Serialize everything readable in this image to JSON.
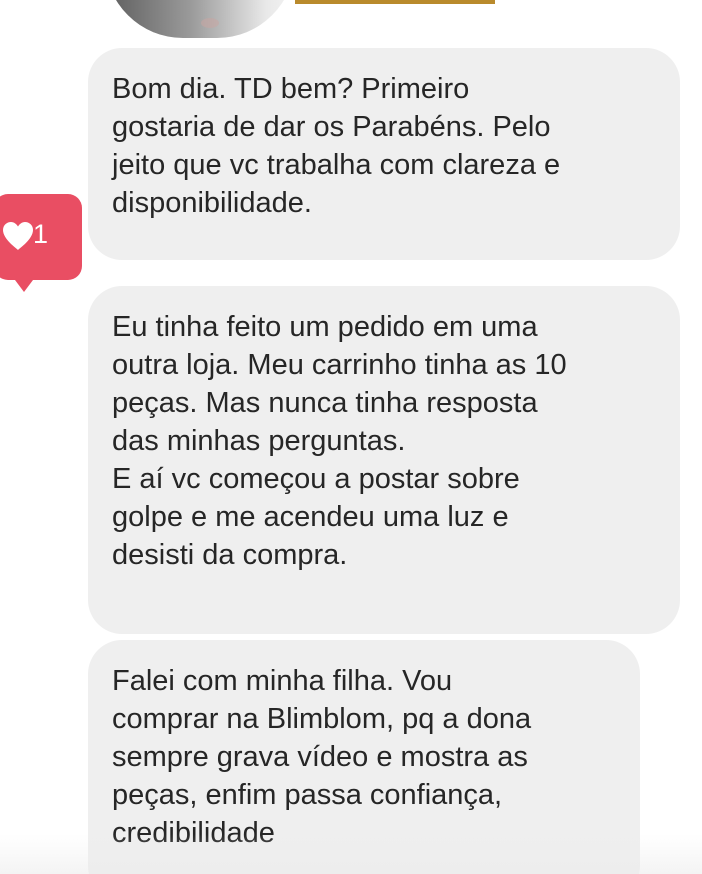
{
  "messages": [
    {
      "text": "Bom dia. TD bem? Primeiro\ngostaria de dar os Parabéns. Pelo\njeito que vc trabalha com clareza e\ndisponibilidade."
    },
    {
      "text": "Eu tinha feito um pedido em uma\noutra loja. Meu carrinho tinha as 10\npeças. Mas nunca tinha resposta\ndas minhas perguntas.\nE aí vc começou a postar sobre\ngolpe e me acendeu uma luz e\ndesisti da compra."
    },
    {
      "text": "Falei com minha filha. Vou\ncomprar na Blimblom, pq a dona\nsempre grava vídeo e mostra as\npeças, enfim passa confiança,\ncredibilidade"
    }
  ],
  "reaction": {
    "icon": "heart-icon",
    "count": "1",
    "color": "#e94e63"
  },
  "colors": {
    "bubble_bg": "#efefef",
    "text": "#262626",
    "background": "#ffffff"
  }
}
